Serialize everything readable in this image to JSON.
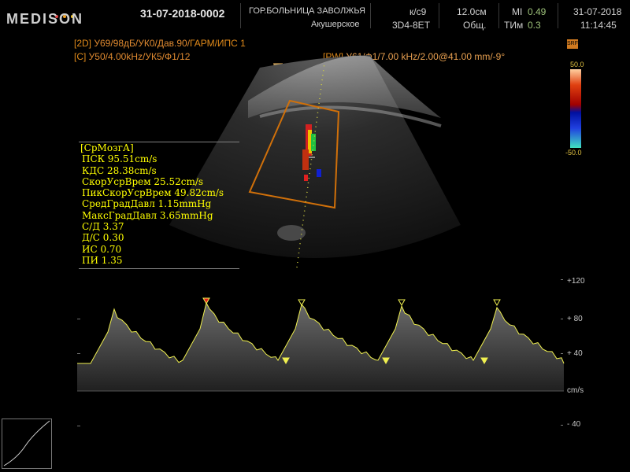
{
  "header": {
    "brand": "MEDISON",
    "patient_id": "31-07-2018-0002",
    "hospital": "ГОР.БОЛЬНИЦА ЗАВОЛЖЬЯ",
    "department": "Акушерское",
    "preset": "к/с9",
    "probe": "3D4-8ET",
    "depth": "12.0см",
    "mode": "Общ.",
    "mi_label": "MI",
    "mi_value": "0.49",
    "tim_label": "ТИм",
    "tim_value": "0.3",
    "date": "31-07-2018",
    "time": "11:14:45"
  },
  "params": {
    "line_2d_tag": "[2D]",
    "line_2d_text": " У69/98дБ/УК0/Дав.90/",
    "line_2d_harm": "ГАРМ/ИПС 1",
    "line_c_tag": "[C]",
    "line_c_text": " У50/4.00kHz/УК5/Ф1/12",
    "line_pw_tag": "[PW]",
    "line_pw_text": " У61/Ф1/7.00 kHz/2.00@41.00 mm/-9°"
  },
  "color_bar": {
    "top_label": "50.0",
    "bottom_label": "-50.0",
    "badge": "SRF"
  },
  "measurements": {
    "title": "[СрМозгА]",
    "items": [
      "ПСК 95.51cm/s",
      "КДС 28.38cm/s",
      "СкорУсрВрем 25.52cm/s",
      "ПикСкорУсрВрем 49.82cm/s",
      "СредГрадДавл 1.15mmHg",
      "МаксГрадДавл 3.65mmHg",
      "С/Д 3.37",
      "Д/С 0.30",
      "ИС 0.70",
      "ПИ  1.35"
    ]
  },
  "doppler_axis": {
    "ticks": [
      "+120",
      "+ 80",
      "+ 40",
      "- 40"
    ],
    "unit": "cm/s"
  }
}
